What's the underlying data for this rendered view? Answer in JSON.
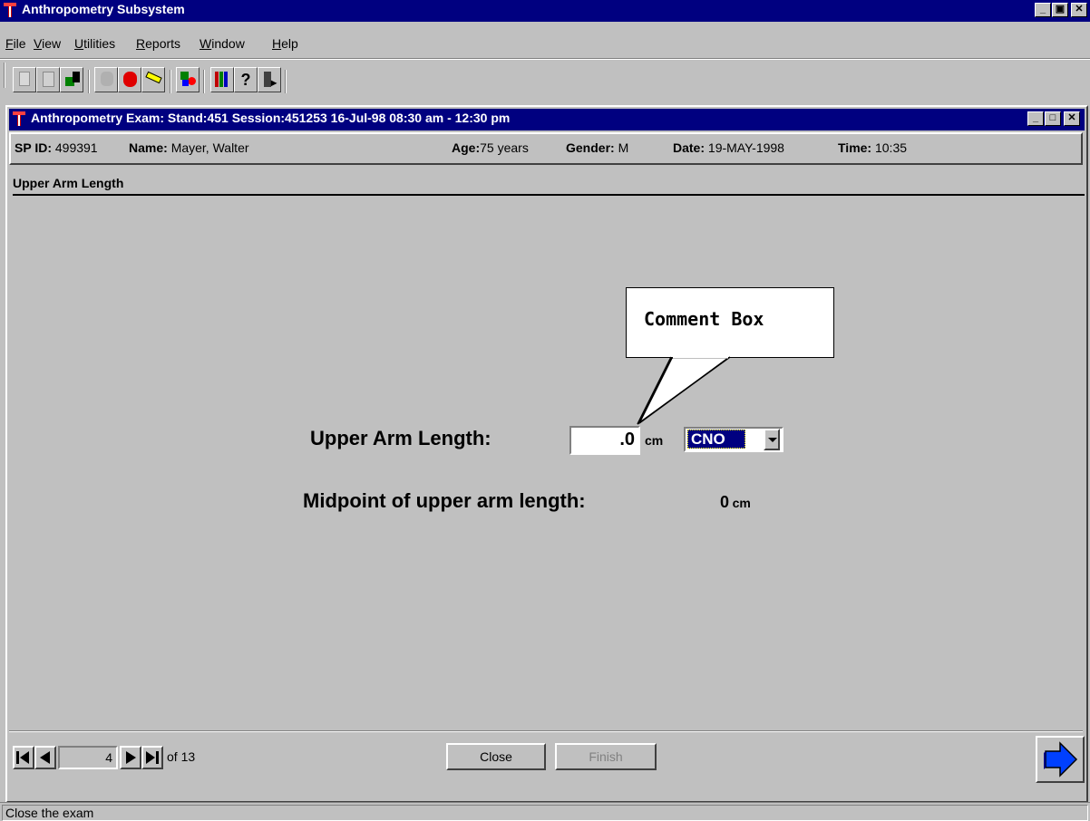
{
  "app": {
    "title": "Anthropometry Subsystem"
  },
  "menu": {
    "items": [
      "File",
      "View",
      "Utilities",
      "Reports",
      "Window",
      "Help"
    ]
  },
  "toolbar": {
    "icons": [
      "new-icon",
      "clipboard-icon",
      "open-icon",
      "hand-print-icon",
      "stop-hand-icon",
      "pencil-icon",
      "shapes-icon",
      "books-icon",
      "help-icon",
      "exit-icon"
    ]
  },
  "exam_window": {
    "title": "Anthropometry Exam: Stand:451 Session:451253 16-Jul-98 08:30 am - 12:30 pm"
  },
  "participant": {
    "sp_id_label": "SP ID:",
    "sp_id": "499391",
    "name_label": "Name:",
    "name": "Mayer, Walter",
    "age_label": "Age:",
    "age": "75 years",
    "gender_label": "Gender:",
    "gender": "M",
    "date_label": "Date:",
    "date": "19-MAY-1998",
    "time_label": "Time:",
    "time": "10:35"
  },
  "section": {
    "title": "Upper Arm Length"
  },
  "form": {
    "upper_arm_label": "Upper Arm Length:",
    "upper_arm_value": ".0",
    "upper_arm_unit": "cm",
    "comment_value": "CNO",
    "midpoint_label": "Midpoint of upper arm length:",
    "midpoint_value": "0",
    "midpoint_unit": "cm"
  },
  "callout": {
    "text": "Comment Box"
  },
  "nav": {
    "current_page": "4",
    "of_text": "of 13"
  },
  "buttons": {
    "close": "Close",
    "finish": "Finish"
  },
  "status": {
    "text": "Close the exam"
  }
}
